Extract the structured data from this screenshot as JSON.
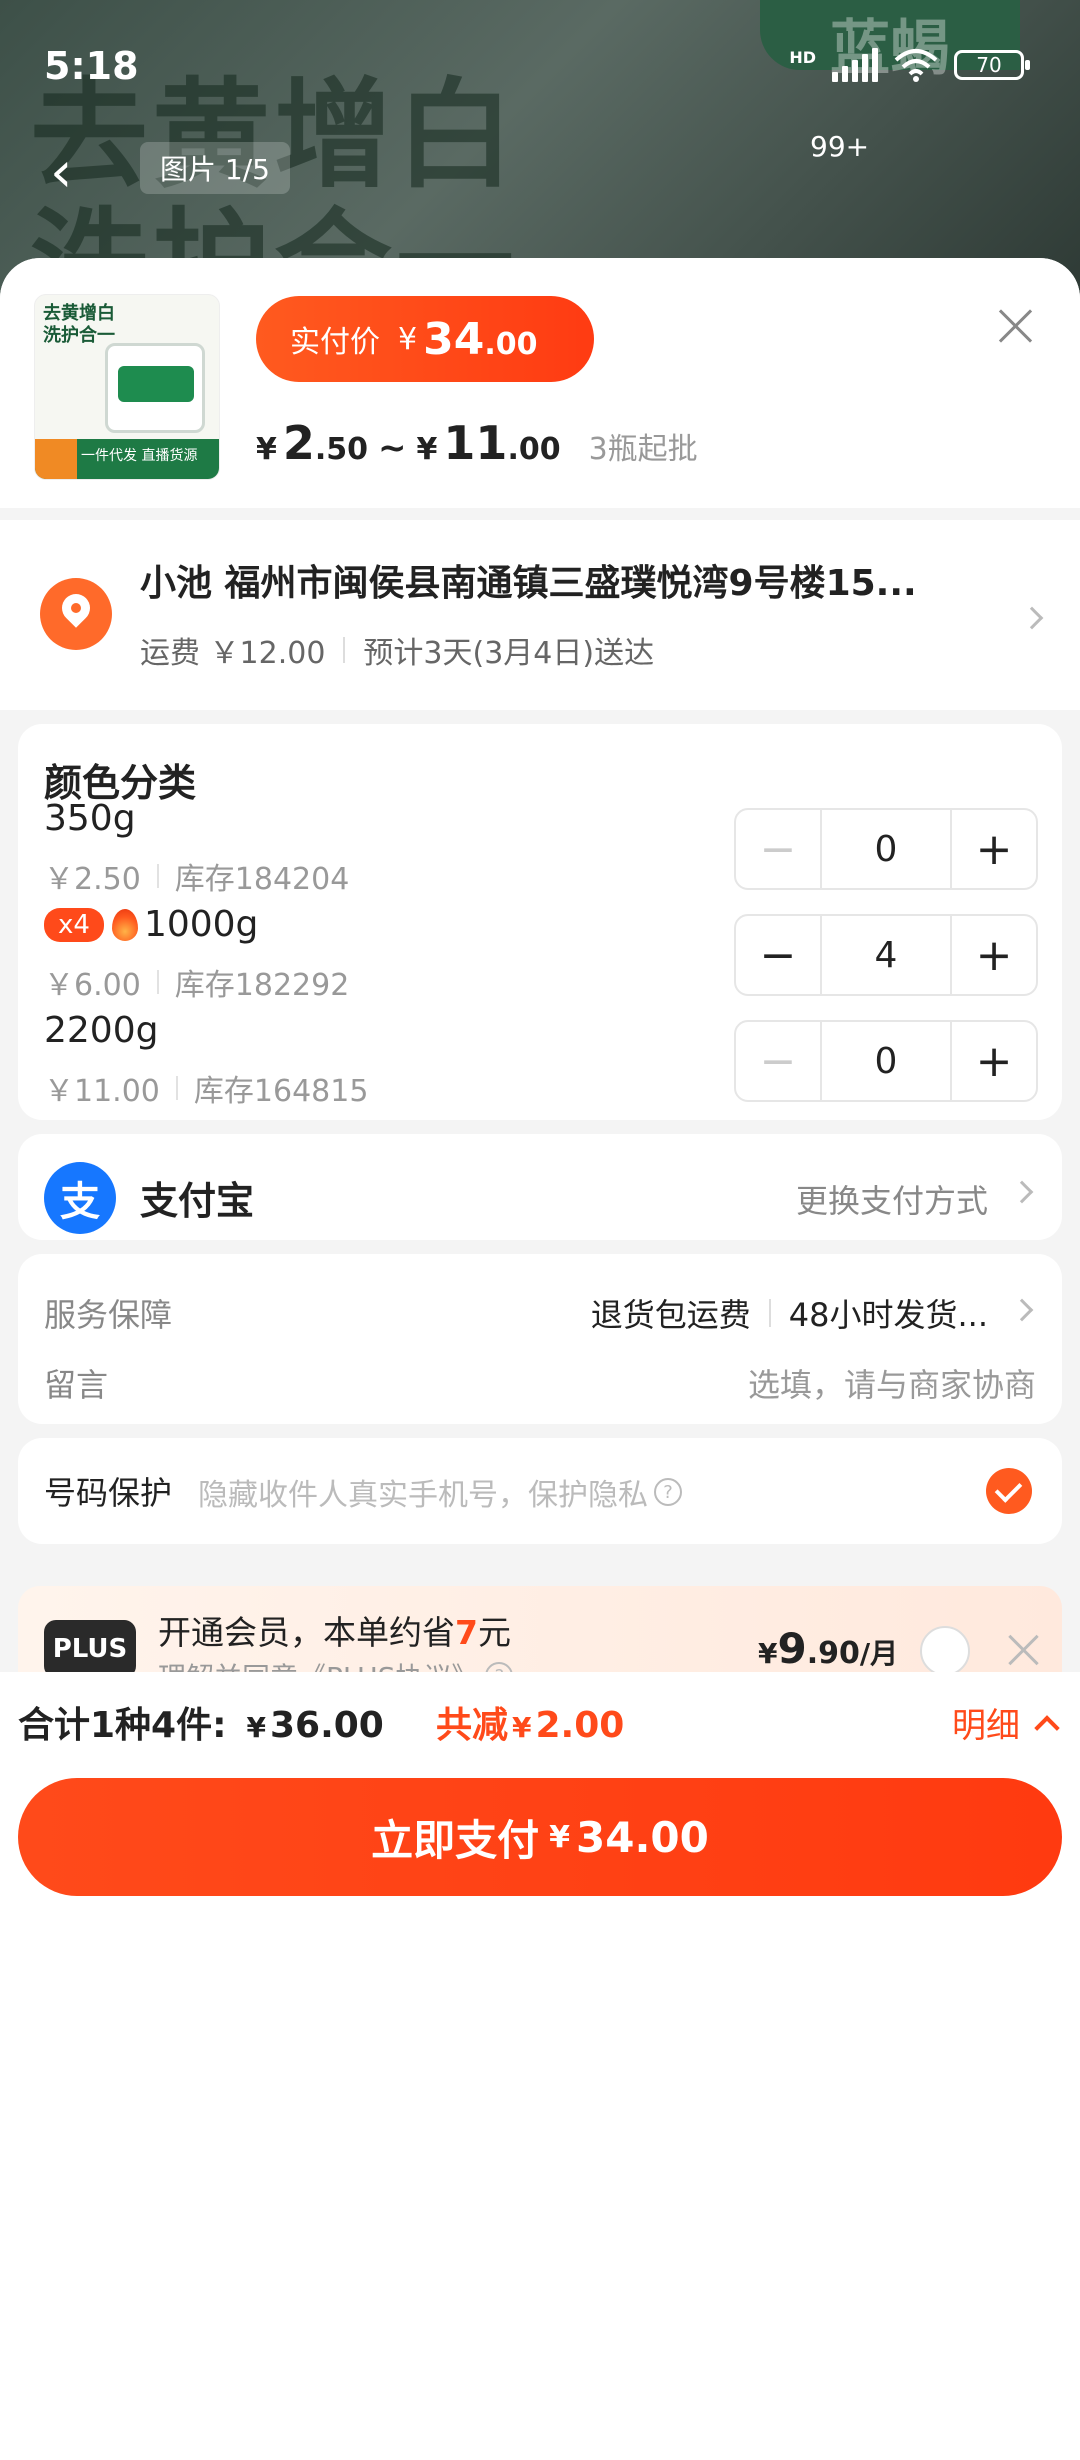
{
  "status_bar": {
    "time": "5:18",
    "battery": "70",
    "network": "HD"
  },
  "background": {
    "big_text_line1": "去黄增白",
    "big_text_line2": "洗护合一",
    "brand": "蓝蝎",
    "image_index": "图片 1/5",
    "cart_badge": "99+"
  },
  "product": {
    "thumb_text_line1": "去黄增白",
    "thumb_text_line2": "洗护合一",
    "thumb_bottom": "一件代发 直播货源",
    "pay_label": "实付价",
    "pay_currency": "¥",
    "pay_amount": "34",
    "pay_decimal": ".00",
    "range_min_int": "2",
    "range_min_dec": ".50",
    "range_max_int": "11",
    "range_max_dec": ".00",
    "range_tilde": "~",
    "currency": "¥",
    "min_qty": "3瓶起批"
  },
  "address": {
    "line": "小池 福州市闽侯县南通镇三盛璞悦湾9号楼15...",
    "shipping": "运费 ￥12.00",
    "eta": "预计3天(3月4日)送达"
  },
  "variants": {
    "title": "颜色分类",
    "items": [
      {
        "name": "350g",
        "price": "￥2.50",
        "stock": "库存184204",
        "qty": "0",
        "tag": ""
      },
      {
        "name": "1000g",
        "price": "￥6.00",
        "stock": "库存182292",
        "qty": "4",
        "tag": "x4"
      },
      {
        "name": "2200g",
        "price": "￥11.00",
        "stock": "库存164815",
        "qty": "0",
        "tag": ""
      }
    ],
    "minus": "−",
    "plus": "+"
  },
  "payment": {
    "icon_char": "支",
    "method": "支付宝",
    "change": "更换支付方式"
  },
  "service": {
    "label": "服务保障",
    "value1": "退货包运费",
    "value2": "48小时发货...",
    "note_label": "留言",
    "note_placeholder": "选填，请与商家协商"
  },
  "phone_protect": {
    "label": "号码保护",
    "desc": "隐藏收件人真实手机号，保护隐私",
    "qmark": "?"
  },
  "plus": {
    "logo": "PLUS",
    "text_before": "开通会员，本单约省",
    "save": "7",
    "text_after": "元",
    "agreement": "理解并同意《PLUS协议》",
    "price_cur": "¥",
    "price_int": "9",
    "price_dec": ".90",
    "price_unit": "/月"
  },
  "summary": {
    "total_label": "合计1种4件:",
    "currency": "¥",
    "total": "36.00",
    "reduce_label": "共减",
    "reduce": "2.00",
    "detail": "明细"
  },
  "pay_button": {
    "label": "立即支付",
    "currency": "¥",
    "amount": "34.00"
  },
  "colors": {
    "accent": "#ff4a1a",
    "alipay": "#1677ff"
  }
}
